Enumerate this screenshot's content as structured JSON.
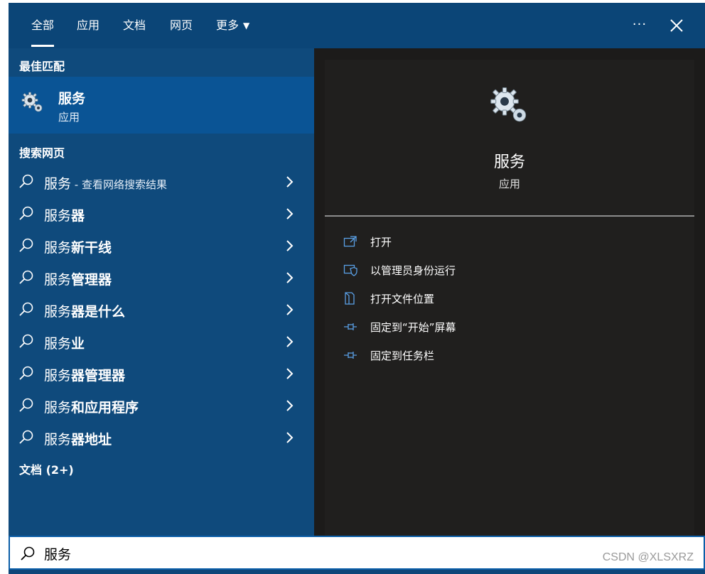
{
  "tabs": [
    {
      "label": "全部",
      "active": true
    },
    {
      "label": "应用"
    },
    {
      "label": "文档"
    },
    {
      "label": "网页"
    },
    {
      "label": "更多"
    }
  ],
  "toolbar": {
    "more_label": "···"
  },
  "best_match": {
    "header": "最佳匹配",
    "title": "服务",
    "subtitle": "应用",
    "icon": "gear-icon"
  },
  "web_search": {
    "header": "搜索网页",
    "items": [
      {
        "base": "服务",
        "bold": "",
        "extra": " - 查看网络搜索结果"
      },
      {
        "base": "服务",
        "bold": "器",
        "extra": ""
      },
      {
        "base": "服务",
        "bold": "新干线",
        "extra": ""
      },
      {
        "base": "服务",
        "bold": "管理器",
        "extra": ""
      },
      {
        "base": "服务",
        "bold": "器是什么",
        "extra": ""
      },
      {
        "base": "服务",
        "bold": "业",
        "extra": ""
      },
      {
        "base": "服务",
        "bold": "器管理器",
        "extra": ""
      },
      {
        "base": "服务",
        "bold": "和应用程序",
        "extra": ""
      },
      {
        "base": "服务",
        "bold": "器地址",
        "extra": ""
      }
    ]
  },
  "documents": {
    "header": "文档 (2+)"
  },
  "detail": {
    "title": "服务",
    "subtitle": "应用",
    "actions": [
      {
        "label": "打开",
        "icon": "open-icon"
      },
      {
        "label": "以管理员身份运行",
        "icon": "shield-icon"
      },
      {
        "label": "打开文件位置",
        "icon": "file-location-icon"
      },
      {
        "label": "固定到“开始”屏幕",
        "icon": "pin-icon"
      },
      {
        "label": "固定到任务栏",
        "icon": "pin-icon"
      }
    ]
  },
  "search": {
    "value": "服务"
  },
  "watermark": "CSDN @XLSXRZ",
  "colors": {
    "header": "#0b4577",
    "left_panel": "#0f4a7c",
    "selected": "#0a5495",
    "right_panel": "#1c1b1a",
    "accent": "#5aa0e6"
  }
}
